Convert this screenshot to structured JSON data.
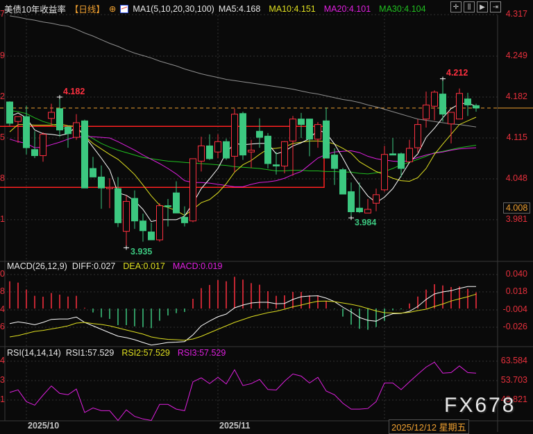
{
  "header": {
    "title": "美债10年收益率",
    "period": "【日线】",
    "ma_label": "MA1(5,10,20,30,100)",
    "ma5": "MA5:4.168",
    "ma10": "MA10:4.151",
    "ma20": "MA20:4.101",
    "ma30": "MA30:4.104",
    "toolbar_icons": [
      "crosshair-icon",
      "bar-chart-icon",
      "play-chart-icon",
      "exit-icon"
    ]
  },
  "colors": {
    "up": "#ff3040",
    "down": "#3cc880",
    "ma5": "#ffffff",
    "ma10": "#e0e020",
    "ma20": "#e020e0",
    "ma30": "#20c020",
    "ma100": "#909090",
    "axis": "#e8303c",
    "rect": "#ff2020",
    "last_line": "#f0a030"
  },
  "main_axis": {
    "labels": [
      "4.317",
      "4.249",
      "4.182",
      "4.115",
      "4.048",
      "3.981"
    ],
    "left_fragments": [
      "7",
      "9",
      "2",
      "5",
      "8",
      "1"
    ],
    "last_price_box": "4.008",
    "last_line_value": 4.164
  },
  "annotations": {
    "high1": "4.182",
    "high2": "4.212",
    "low1": "3.935",
    "low2": "3.984"
  },
  "chart_data": [
    {
      "type": "candlestick",
      "title": "美债10年收益率【日线】",
      "ylim": [
        3.913,
        4.317
      ],
      "ohlc": [
        [
          4.174,
          4.175,
          4.135,
          4.139
        ],
        [
          4.142,
          4.15,
          4.107,
          4.15
        ],
        [
          4.15,
          4.168,
          4.088,
          4.099
        ],
        [
          4.096,
          4.126,
          4.082,
          4.086
        ],
        [
          4.086,
          4.124,
          4.076,
          4.121
        ],
        [
          4.147,
          4.171,
          4.135,
          4.157
        ],
        [
          4.163,
          4.182,
          4.117,
          4.128
        ],
        [
          4.133,
          4.135,
          4.099,
          4.122
        ],
        [
          4.116,
          4.154,
          4.112,
          4.14
        ],
        [
          4.143,
          4.145,
          4.033,
          4.033
        ],
        [
          4.065,
          4.084,
          4.051,
          4.051
        ],
        [
          4.051,
          4.07,
          3.999,
          4.033
        ],
        [
          4.032,
          4.049,
          4.0,
          4.034
        ],
        [
          4.032,
          4.051,
          3.969,
          3.976
        ],
        [
          3.962,
          4.021,
          3.935,
          4.011
        ],
        [
          4.016,
          4.029,
          3.966,
          3.979
        ],
        [
          3.979,
          3.991,
          3.945,
          3.963
        ],
        [
          3.961,
          3.976,
          3.948,
          3.948
        ],
        [
          3.948,
          4.008,
          3.945,
          4.004
        ],
        [
          4.004,
          4.015,
          3.97,
          4.003
        ],
        [
          4.025,
          4.044,
          3.992,
          3.992
        ],
        [
          3.985,
          4.003,
          3.97,
          3.976
        ],
        [
          3.979,
          4.081,
          3.977,
          4.081
        ],
        [
          4.077,
          4.117,
          4.06,
          4.102
        ],
        [
          4.102,
          4.121,
          4.079,
          4.081
        ],
        [
          4.092,
          4.121,
          4.082,
          4.109
        ],
        [
          4.109,
          4.114,
          4.079,
          4.082
        ],
        [
          4.085,
          4.163,
          4.059,
          4.154
        ],
        [
          4.155,
          4.158,
          4.079,
          4.087
        ],
        [
          4.092,
          4.112,
          4.066,
          4.095
        ],
        [
          4.126,
          4.147,
          4.099,
          4.116
        ],
        [
          4.118,
          4.123,
          4.065,
          4.073
        ],
        [
          4.071,
          4.092,
          4.055,
          4.069
        ],
        [
          4.069,
          4.11,
          4.057,
          4.109
        ],
        [
          4.11,
          4.151,
          4.053,
          4.146
        ],
        [
          4.146,
          4.156,
          4.115,
          4.137
        ],
        [
          4.146,
          4.146,
          4.085,
          4.113
        ],
        [
          4.113,
          4.141,
          4.099,
          4.137
        ],
        [
          4.143,
          4.165,
          4.082,
          4.082
        ],
        [
          4.087,
          4.098,
          4.038,
          4.065
        ],
        [
          4.063,
          4.066,
          4.023,
          4.023
        ],
        [
          4.027,
          4.042,
          3.984,
          3.994
        ],
        [
          4.0,
          4.042,
          3.992,
          3.994
        ],
        [
          3.992,
          4.015,
          3.992,
          3.998
        ],
        [
          4.008,
          4.032,
          3.995,
          4.022
        ],
        [
          4.03,
          4.102,
          4.027,
          4.088
        ],
        [
          4.089,
          4.115,
          4.087,
          4.087
        ],
        [
          4.089,
          4.091,
          4.051,
          4.065
        ],
        [
          4.076,
          4.112,
          4.076,
          4.098
        ],
        [
          4.099,
          4.146,
          4.091,
          4.137
        ],
        [
          4.146,
          4.191,
          4.132,
          4.169
        ],
        [
          4.167,
          4.193,
          4.144,
          4.19
        ],
        [
          4.187,
          4.212,
          4.142,
          4.154
        ],
        [
          4.138,
          4.157,
          4.106,
          4.157
        ],
        [
          4.146,
          4.196,
          4.146,
          4.188
        ],
        [
          4.179,
          4.189,
          4.151,
          4.169
        ],
        [
          4.168,
          4.171,
          4.158,
          4.164
        ]
      ],
      "ma": {
        "ma5": [
          4.15,
          4.156,
          4.148,
          4.128,
          4.122,
          4.121,
          4.119,
          4.122,
          4.134,
          4.118,
          4.1,
          4.082,
          4.063,
          4.025,
          4.021,
          4.012,
          3.998,
          3.978,
          3.981,
          3.981,
          3.981,
          3.987,
          4.008,
          4.032,
          4.048,
          4.065,
          4.091,
          4.106,
          4.104,
          4.105,
          4.106,
          4.106,
          4.089,
          4.093,
          4.102,
          4.107,
          4.114,
          4.128,
          4.123,
          4.105,
          4.082,
          4.057,
          4.038,
          4.02,
          4.009,
          4.018,
          4.032,
          4.053,
          4.075,
          4.089,
          4.116,
          4.131,
          4.148,
          4.163,
          4.171,
          4.172,
          4.167
        ],
        "ma10": [
          4.125,
          4.137,
          4.137,
          4.136,
          4.136,
          4.136,
          4.138,
          4.135,
          4.134,
          4.118,
          4.106,
          4.097,
          4.088,
          4.08,
          4.068,
          4.055,
          4.038,
          4.02,
          4.005,
          4.001,
          3.996,
          3.988,
          3.998,
          4.009,
          4.014,
          4.025,
          4.04,
          4.059,
          4.071,
          4.078,
          4.088,
          4.097,
          4.098,
          4.1,
          4.106,
          4.108,
          4.11,
          4.11,
          4.109,
          4.105,
          4.098,
          4.09,
          4.076,
          4.068,
          4.06,
          4.055,
          4.049,
          4.045,
          4.044,
          4.05,
          4.065,
          4.088,
          4.105,
          4.121,
          4.137,
          4.143,
          4.149
        ],
        "ma20": [
          4.113,
          4.109,
          4.106,
          4.099,
          4.1,
          4.104,
          4.108,
          4.113,
          4.117,
          4.117,
          4.117,
          4.116,
          4.115,
          4.109,
          4.102,
          4.095,
          4.087,
          4.08,
          4.073,
          4.065,
          4.056,
          4.045,
          4.042,
          4.042,
          4.041,
          4.039,
          4.037,
          4.035,
          4.035,
          4.039,
          4.042,
          4.043,
          4.045,
          4.049,
          4.055,
          4.06,
          4.071,
          4.082,
          4.088,
          4.092,
          4.093,
          4.094,
          4.091,
          4.085,
          4.081,
          4.079,
          4.077,
          4.076,
          4.078,
          4.083,
          4.087,
          4.09,
          4.092,
          4.095,
          4.097,
          4.098,
          4.099
        ],
        "ma30": [
          4.16,
          4.158,
          4.155,
          4.148,
          4.142,
          4.138,
          4.133,
          4.129,
          4.126,
          4.123,
          4.114,
          4.106,
          4.1,
          4.095,
          4.091,
          4.087,
          4.083,
          4.081,
          4.079,
          4.077,
          4.076,
          4.075,
          4.074,
          4.073,
          4.072,
          4.071,
          4.07,
          4.068,
          4.067,
          4.066,
          4.065,
          4.063,
          4.061,
          4.061,
          4.062,
          4.062,
          4.061,
          4.061,
          4.06,
          4.06,
          4.059,
          4.059,
          4.057,
          4.056,
          4.058,
          4.06,
          4.065,
          4.071,
          4.075,
          4.08,
          4.085,
          4.091,
          4.093,
          4.096,
          4.099,
          4.101,
          4.103
        ],
        "ma100": [
          4.315,
          4.313,
          4.31,
          4.308,
          4.305,
          4.303,
          4.3,
          4.298,
          4.293,
          4.287,
          4.282,
          4.276,
          4.27,
          4.265,
          4.259,
          4.254,
          4.25,
          4.246,
          4.241,
          4.237,
          4.233,
          4.228,
          4.224,
          4.22,
          4.217,
          4.214,
          4.211,
          4.209,
          4.207,
          4.205,
          4.203,
          4.201,
          4.199,
          4.197,
          4.195,
          4.192,
          4.189,
          4.187,
          4.184,
          4.181,
          4.178,
          4.176,
          4.173,
          4.169,
          4.166,
          4.162,
          4.158,
          4.154,
          4.15,
          4.146,
          4.144,
          4.142,
          4.14,
          4.138,
          4.137,
          4.135,
          4.133
        ]
      },
      "box_zone": {
        "top": 4.134,
        "bottom": 4.034,
        "end_bar": 39
      }
    },
    {
      "type": "bar+line",
      "title": "MACD(26,12,9)",
      "ylim": [
        -0.04,
        0.045
      ],
      "tick_labels": [
        "0.040",
        "0.018",
        "-0.004",
        "-0.026"
      ],
      "left_fragments": [
        "0",
        "8",
        "4",
        "6"
      ],
      "legend": {
        "diff": "DIFF:0.027",
        "dea": "DEA:0.017",
        "macd": "MACD:0.019"
      },
      "macd": [
        0.0341,
        0.0324,
        0.0237,
        0.0159,
        0.0148,
        0.0194,
        0.0174,
        0.015,
        0.0159,
        0.001,
        -0.0049,
        -0.011,
        -0.013,
        -0.0208,
        -0.0208,
        -0.0223,
        -0.0232,
        -0.0246,
        -0.0153,
        -0.0087,
        -0.0058,
        -0.0043,
        0.0122,
        0.0255,
        0.0295,
        0.0356,
        0.0341,
        0.0397,
        0.0362,
        0.0318,
        0.0298,
        0.0217,
        0.0159,
        0.0165,
        0.0208,
        0.0208,
        0.0165,
        0.0165,
        0.0093,
        -0.0005,
        -0.0101,
        -0.0202,
        -0.0254,
        -0.0266,
        -0.0231,
        -0.0153,
        -0.0023,
        -0.0009,
        0.0063,
        0.015,
        0.0237,
        0.0304,
        0.0289,
        0.0269,
        0.0275,
        0.0246,
        0.0202
      ],
      "diff": [
        -0.0214,
        -0.0193,
        -0.0208,
        -0.0228,
        -0.0199,
        -0.0162,
        -0.0156,
        -0.0156,
        -0.0132,
        -0.0199,
        -0.0242,
        -0.0286,
        -0.0329,
        -0.0372,
        -0.039,
        -0.0416,
        -0.0451,
        -0.0483,
        -0.0468,
        -0.0451,
        -0.0446,
        -0.0439,
        -0.0355,
        -0.0242,
        -0.0182,
        -0.0129,
        -0.0095,
        -0.0017,
        0.0018,
        0.0044,
        0.0053,
        0.0053,
        0.0035,
        0.0038,
        0.0088,
        0.0122,
        0.0131,
        0.0134,
        0.0105,
        0.0061,
        -0.0008,
        -0.0069,
        -0.0138,
        -0.0173,
        -0.0184,
        -0.0129,
        -0.009,
        -0.0086,
        -0.006,
        0.0001,
        0.0088,
        0.0157,
        0.0183,
        0.0198,
        0.0226,
        0.025,
        0.025
      ],
      "dea": [
        -0.0381,
        -0.0364,
        -0.0338,
        -0.0312,
        -0.03,
        -0.0281,
        -0.0264,
        -0.0242,
        -0.0208,
        -0.0199,
        -0.0214,
        -0.0225,
        -0.0242,
        -0.0268,
        -0.0294,
        -0.032,
        -0.0346,
        -0.0381,
        -0.0399,
        -0.0412,
        -0.0416,
        -0.0422,
        -0.0407,
        -0.0373,
        -0.0329,
        -0.0286,
        -0.0242,
        -0.0199,
        -0.0164,
        -0.0129,
        -0.0103,
        -0.0077,
        -0.006,
        -0.0034,
        -0.0004,
        0.0018,
        0.0044,
        0.0066,
        0.0068,
        0.0061,
        0.0044,
        0.0027,
        0.0005,
        -0.0025,
        -0.0056,
        -0.0077,
        -0.0082,
        -0.0083,
        -0.0073,
        -0.0051,
        -0.0034,
        0.0001,
        0.0031,
        0.0068,
        0.0096,
        0.0122,
        0.0154
      ]
    },
    {
      "type": "line",
      "title": "RSI(14,14,14)",
      "tick_labels": [
        "63.584",
        "53.703",
        "43.821"
      ],
      "left_fragments": [
        "4",
        "3",
        "1"
      ],
      "legend": {
        "rsi1": "RSI1:57.529",
        "rsi2": "RSI2:57.529",
        "rsi3": "RSI3:57.529"
      },
      "rsi": [
        47.7,
        49.0,
        43.0,
        41.2,
        46.3,
        51.0,
        47.2,
        46.5,
        49.4,
        37.5,
        39.8,
        38.4,
        38.4,
        33.4,
        38.8,
        35.5,
        34.2,
        33.4,
        41.6,
        41.6,
        39.2,
        38.4,
        53.1,
        55.1,
        52.2,
        55.4,
        52.0,
        59.2,
        51.2,
        52.2,
        54.3,
        49.2,
        48.9,
        53.4,
        57.1,
        56.0,
        52.5,
        55.4,
        48.4,
        46.5,
        42.2,
        39.2,
        39.2,
        39.5,
        43.0,
        52.5,
        52.5,
        49.1,
        53.1,
        56.9,
        60.6,
        63.1,
        57.5,
        57.8,
        61.2,
        57.8,
        57.5
      ]
    }
  ],
  "date_axis": {
    "labels": [
      "2025/10",
      "2025/11"
    ],
    "crosshair_date": "2025/12/12 星期五"
  },
  "watermark": "FX678"
}
